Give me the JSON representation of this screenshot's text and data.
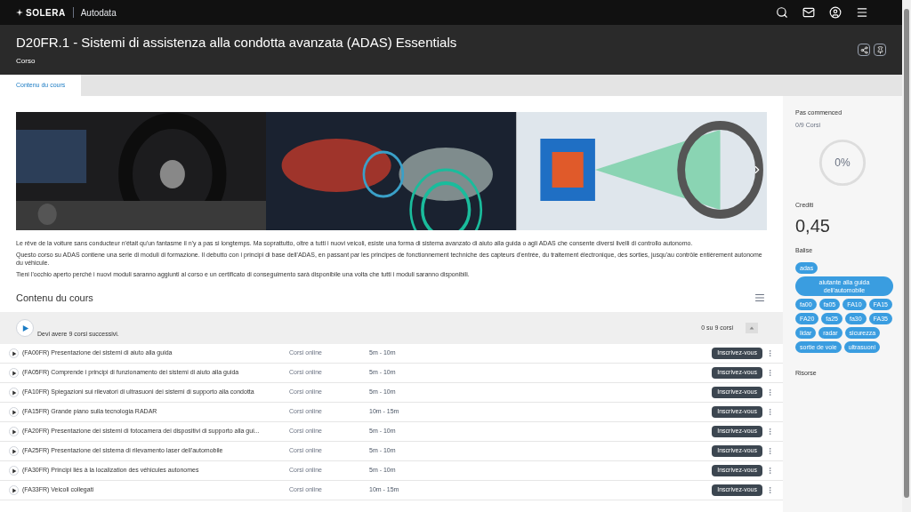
{
  "brand": {
    "logo": "SOLERA",
    "product": "Autodata"
  },
  "header": {
    "title": "D20FR.1 - Sistemi di assistenza alla condotta avanzata (ADAS) Essentials",
    "subtitle": "Corso"
  },
  "tabs": [
    {
      "label": "Contenu du cours",
      "selected": true
    }
  ],
  "description": [
    "Le rêve de la voiture sans conducteur n'était qu'un fantasme il n'y a pas si longtemps. Ma soprattutto, oltre a tutti i nuovi veicoli, esiste una forma di sistema avanzato di aiuto alla guida o agli ADAS che consente diversi livelli di controllo autonomo.",
    "Questo corso su ADAS contiene una serie di moduli di formazione. Il debutto con i principi di base dell'ADAS, en passant par les principes de fonctionnement techniche des capteurs d'entrée, du traitement électronique, des sorties, jusqu'au contrôle entièrement autonome du véhicule.",
    "Tieni l'occhio aperto perché i nuovi moduli saranno aggiunti al corso e un certificato di conseguimento sarà disponibile una volta che tutti i moduli saranno disponibili."
  ],
  "content": {
    "title": "Contenu du cours",
    "group_note": "Devi avere 9 corsi successivi.",
    "group_count": "0 su 9 corsi",
    "rows": [
      {
        "title": "(FA00FR) Presentazione dei sistemi di aiuto alla guida",
        "type": "Corsi online",
        "duration": "5m - 10m",
        "action": "Inscrivez-vous"
      },
      {
        "title": "(FA05FR) Comprende i principi di funzionamento dei sistemi di aiuto alla guida",
        "type": "Corsi online",
        "duration": "5m - 10m",
        "action": "Inscrivez-vous"
      },
      {
        "title": "(FA10FR) Spiegazioni sui rilevatori di ultrasuoni dei sistemi di supporto alla condotta",
        "type": "Corsi online",
        "duration": "5m - 10m",
        "action": "Inscrivez-vous"
      },
      {
        "title": "(FA15FR) Grande piano sulla tecnologia RADAR",
        "type": "Corsi online",
        "duration": "10m - 15m",
        "action": "Inscrivez-vous"
      },
      {
        "title": "(FA20FR) Presentazione dei sistemi di fotocamera dei dispositivi di supporto alla gui...",
        "type": "Corsi online",
        "duration": "5m - 10m",
        "action": "Inscrivez-vous"
      },
      {
        "title": "(FA25FR) Presentazione del sistema di rilevamento laser dell'automobile",
        "type": "Corsi online",
        "duration": "5m - 10m",
        "action": "Inscrivez-vous"
      },
      {
        "title": "(FA30FR) Principi liés à la localization des véhicules autonomes",
        "type": "Corsi online",
        "duration": "5m - 10m",
        "action": "Inscrivez-vous"
      },
      {
        "title": "(FA33FR) Veicoli collegati",
        "type": "Corsi online",
        "duration": "10m - 15m",
        "action": "Inscrivez-vous"
      }
    ]
  },
  "sidebar": {
    "status": "Pas commenced",
    "progress_text": "0/9 Corsi",
    "progress": {
      "level": 0,
      "label": "0%"
    },
    "credits_label": "Crediti",
    "credits": "0,45",
    "tags_label": "Balise",
    "tags": [
      "adas",
      "aiutante alla guida dell'automobile",
      "fa00",
      "fa05",
      "FA10",
      "FA15",
      "FA20",
      "fa25",
      "fa30",
      "FA35",
      "lidar",
      "radar",
      "sicurezza",
      "sortie de voie",
      "ultrasuoni"
    ],
    "resources_label": "Risorse"
  }
}
